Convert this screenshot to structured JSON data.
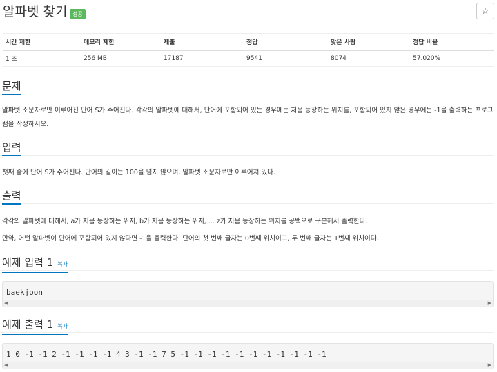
{
  "header": {
    "title": "알파벳 찾기",
    "badge": "성공",
    "star": "☆"
  },
  "info_table": {
    "headers": [
      "시간 제한",
      "메모리 제한",
      "제출",
      "정답",
      "맞은 사람",
      "정답 비율"
    ],
    "values": [
      "1 초",
      "256 MB",
      "17187",
      "9541",
      "8074",
      "57.020%"
    ]
  },
  "sections": {
    "problem": {
      "title": "문제",
      "text": "알파벳 소문자로만 이루어진 단어 S가 주어진다. 각각의 알파벳에 대해서, 단어에 포함되어 있는 경우에는 처음 등장하는 위치를, 포함되어 있지 않은 경우에는 -1을 출력하는 프로그램을 작성하시오."
    },
    "input": {
      "title": "입력",
      "text": "첫째 줄에 단어 S가 주어진다. 단어의 길이는 100을 넘지 않으며, 알파벳 소문자로만 이루어져 있다."
    },
    "output": {
      "title": "출력",
      "text1": "각각의 알파벳에 대해서, a가 처음 등장하는 위치, b가 처음 등장하는 위치, ... z가 처음 등장하는 위치를 공백으로 구분해서 출력한다.",
      "text2": "만약, 어떤 알파벳이 단어에 포함되어 있지 않다면 -1을 출력한다. 단어의 첫 번째 글자는 0번째 위치이고, 두 번째 글자는 1번째 위치이다."
    },
    "sample_input": {
      "title": "예제 입력 1",
      "copy": "복사",
      "code": "baekjoon"
    },
    "sample_output": {
      "title": "예제 출력 1",
      "copy": "복사",
      "code": "1 0 -1 -1 2 -1 -1 -1 -1 4 3 -1 -1 7 5 -1 -1 -1 -1 -1 -1 -1 -1 -1 -1 -1"
    }
  },
  "colors": {
    "accent": "#0076c0",
    "badge": "#5cb85c"
  }
}
